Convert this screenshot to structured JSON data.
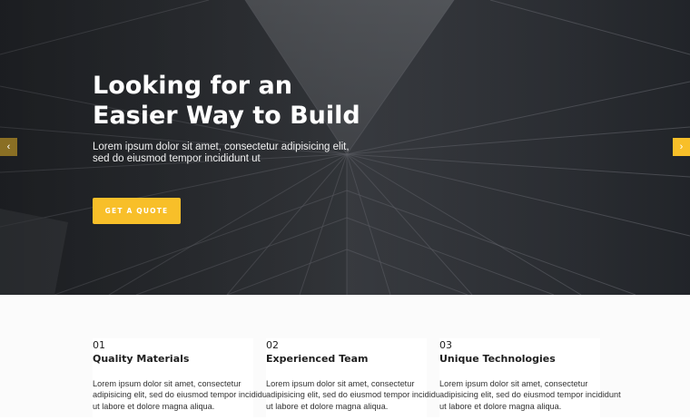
{
  "hero": {
    "title_lines": [
      "Looking for an",
      "Easier Way to Build"
    ],
    "subtitle_lines": [
      "Lorem ipsum dolor sit amet, consectetur adipisicing elit,",
      "sed do eiusmod tempor incididunt ut"
    ],
    "cta_label": "GET A QUOTE",
    "prev_icon": "‹",
    "next_icon": "›"
  },
  "features": [
    {
      "number": "01",
      "title": "Quality Materials",
      "text_lines": [
        "Lorem ipsum dolor sit amet, consectetur",
        "adipisicing elit, sed do eiusmod tempor incididunt",
        "ut labore et dolore magna aliqua."
      ]
    },
    {
      "number": "02",
      "title": "Experienced Team",
      "text_lines": [
        "Lorem ipsum dolor sit amet, consectetur",
        "adipisicing elit, sed do eiusmod tempor incididunt",
        "ut labore et dolore magna aliqua."
      ]
    },
    {
      "number": "03",
      "title": "Unique Technologies",
      "text_lines": [
        "Lorem ipsum dolor sit amet, consectetur",
        "adipisicing elit, sed do eiusmod tempor incididunt",
        "ut labore et dolore magna aliqua."
      ]
    }
  ],
  "colors": {
    "accent": "#f8bf29",
    "accent_dark": "#8a6f24",
    "hero_dark": "#2e3136"
  }
}
